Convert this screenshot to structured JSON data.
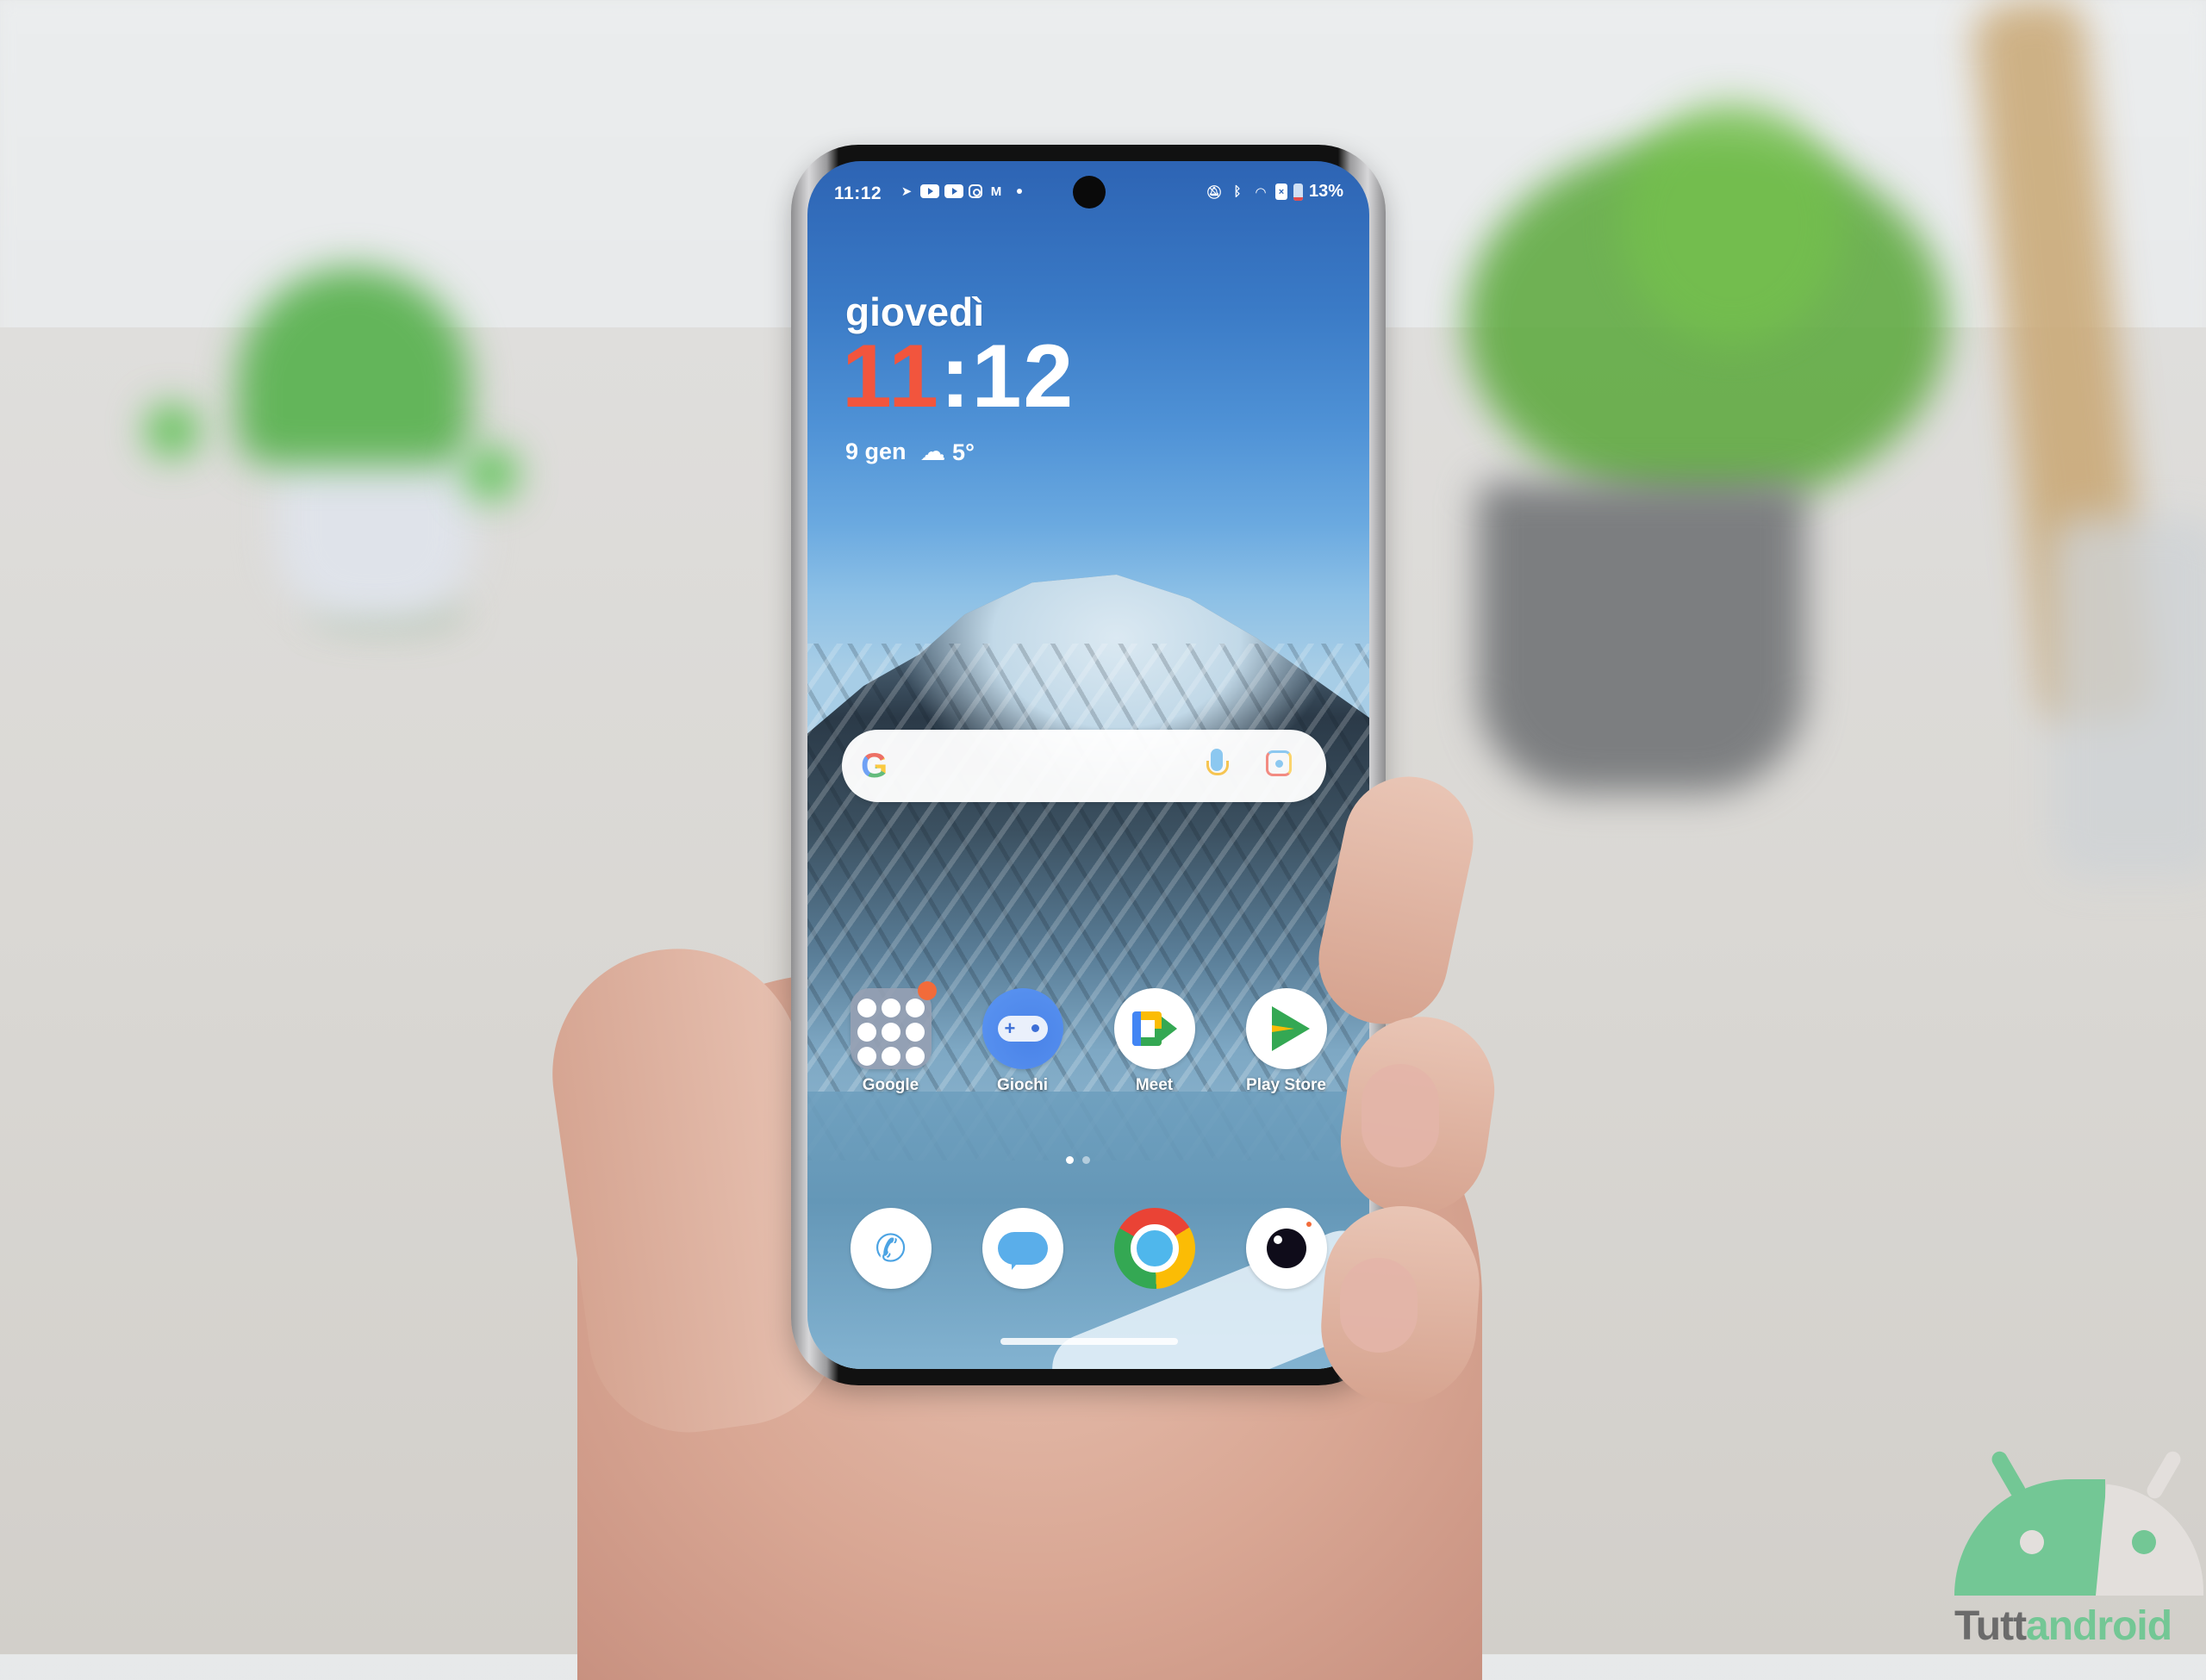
{
  "scene": {
    "description": "Hand holding a smartphone showing Android home screen",
    "background_objects": [
      "android-figurine",
      "potted-plant",
      "desk-lamp"
    ]
  },
  "status_bar": {
    "time": "11:12",
    "notification_icons": [
      "telegram-icon",
      "youtube-icon",
      "youtube-icon",
      "instagram-icon",
      "gmail-icon",
      "more-dot-icon"
    ],
    "system_icons": [
      "mute-icon",
      "bluetooth-icon",
      "wifi-icon",
      "sim-icon",
      "battery-icon"
    ],
    "battery_percent_label": "13%",
    "battery_level": 0.13
  },
  "clock_widget": {
    "day": "giovedì",
    "hours": "11",
    "separator": ":",
    "minutes": "12",
    "date": "9 gen",
    "weather_icon": "partly-cloudy-icon",
    "temperature": "5°",
    "hour_color": "#f2553d"
  },
  "search_bar": {
    "logo": "G",
    "mic_icon": "mic-icon",
    "lens_icon": "lens-icon"
  },
  "apps": [
    {
      "label": "Google",
      "icon": "folder-icon",
      "badge": true
    },
    {
      "label": "Giochi",
      "icon": "gamepad-icon"
    },
    {
      "label": "Meet",
      "icon": "meet-icon"
    },
    {
      "label": "Play Store",
      "icon": "play-store-icon"
    }
  ],
  "dock": [
    {
      "name": "Telefono",
      "icon": "phone-icon"
    },
    {
      "name": "Messaggi",
      "icon": "messages-icon"
    },
    {
      "name": "Chrome",
      "icon": "chrome-icon"
    },
    {
      "name": "Fotocamera",
      "icon": "camera-icon"
    }
  ],
  "pager": {
    "pages": 2,
    "active": 0
  },
  "watermark": {
    "part1": "Tutt",
    "part2": "android"
  },
  "colors": {
    "wallpaper_sky": "#3a7ac6",
    "badge": "#f26b3a",
    "watermark_green": "#73c795",
    "watermark_gray": "#6b6b6b"
  }
}
